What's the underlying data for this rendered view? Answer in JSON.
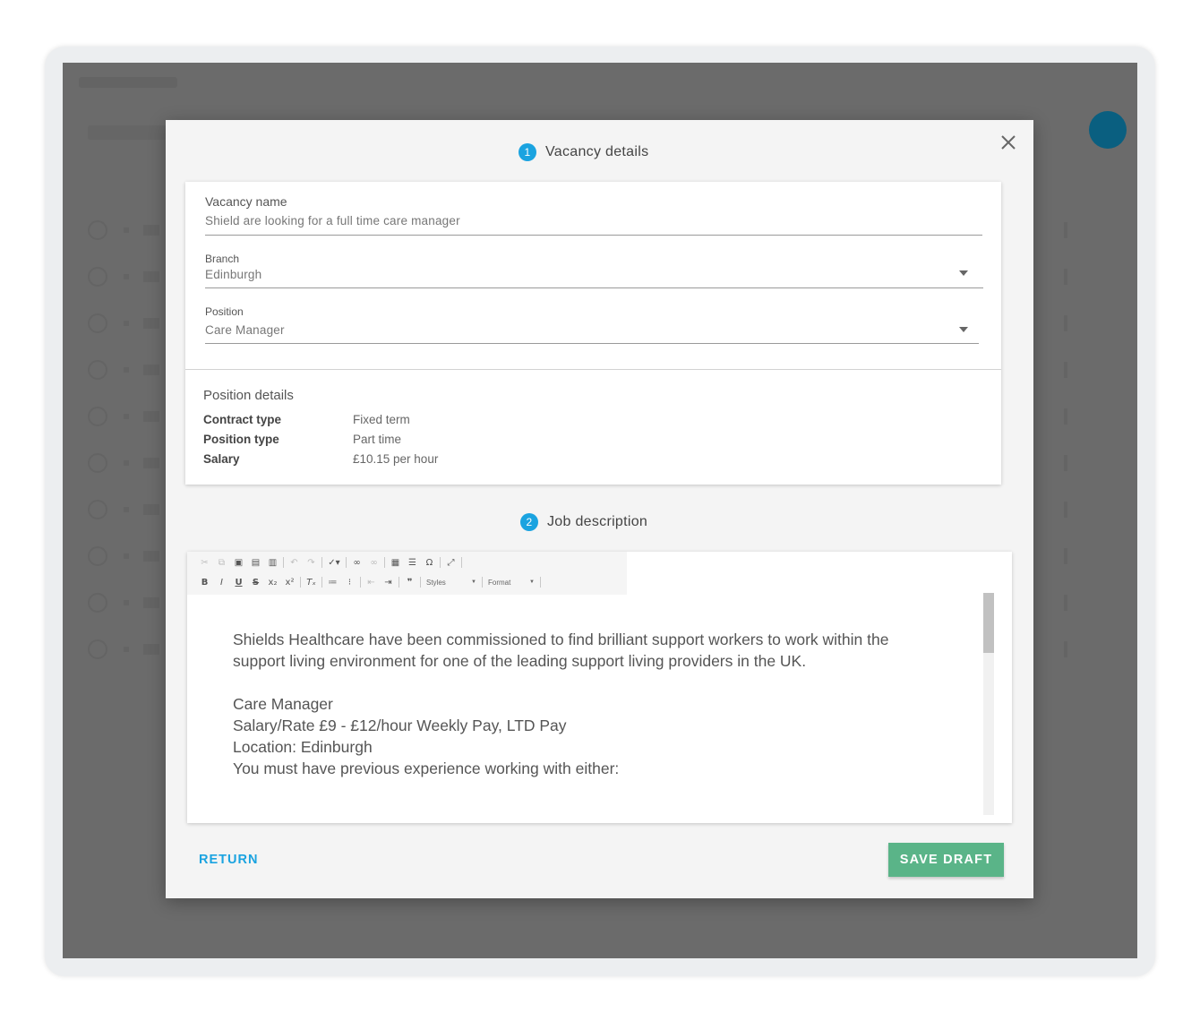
{
  "modal": {
    "step1": {
      "number": "1",
      "title": "Vacancy details"
    },
    "step2": {
      "number": "2",
      "title": "Job description"
    },
    "vacancy_name": {
      "label": "Vacancy name",
      "value": "Shield are looking for a full time care manager"
    },
    "branch": {
      "label": "Branch",
      "value": "Edinburgh"
    },
    "position": {
      "label": "Position",
      "value": "Care Manager"
    },
    "position_details": {
      "title": "Position details",
      "rows": [
        {
          "key": "Contract type",
          "value": "Fixed term"
        },
        {
          "key": "Position type",
          "value": "Part time"
        },
        {
          "key": "Salary",
          "value": "£10.15 per hour"
        }
      ]
    },
    "editor": {
      "toolbar": {
        "styles_label": "Styles",
        "format_label": "Format"
      },
      "content": {
        "p1": "Shields Healthcare have been commissioned to find brilliant support workers to work within the support living environment for one of the leading support living providers in the UK.",
        "l1": "Care Manager",
        "l2": "Salary/Rate £9 - £12/hour Weekly Pay, LTD Pay",
        "l3": "Location: Edinburgh",
        "l4": "You must have previous experience working with either:"
      }
    },
    "actions": {
      "return_label": "RETURN",
      "save_label": "SAVE DRAFT"
    }
  },
  "colors": {
    "accent": "#1aa3e0",
    "save": "#5ab488",
    "overlay": "#6b6b6b"
  }
}
